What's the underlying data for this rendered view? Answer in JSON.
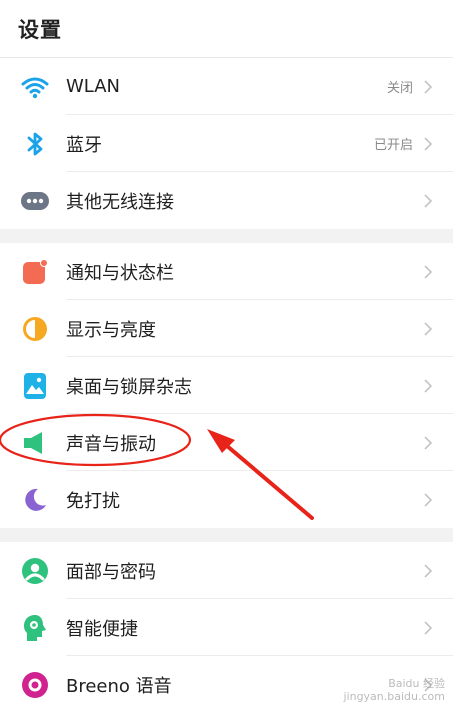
{
  "header": {
    "title": "设置"
  },
  "groups": [
    {
      "items": [
        {
          "label": "WLAN",
          "value": "关闭",
          "icon": "wifi-icon"
        },
        {
          "label": "蓝牙",
          "value": "已开启",
          "icon": "bluetooth-icon"
        },
        {
          "label": "其他无线连接",
          "value": "",
          "icon": "more-connections-icon"
        }
      ]
    },
    {
      "items": [
        {
          "label": "通知与状态栏",
          "value": "",
          "icon": "notification-icon"
        },
        {
          "label": "显示与亮度",
          "value": "",
          "icon": "display-brightness-icon"
        },
        {
          "label": "桌面与锁屏杂志",
          "value": "",
          "icon": "wallpaper-icon"
        },
        {
          "label": "声音与振动",
          "value": "",
          "icon": "sound-icon"
        },
        {
          "label": "免打扰",
          "value": "",
          "icon": "moon-icon"
        }
      ]
    },
    {
      "items": [
        {
          "label": "面部与密码",
          "value": "",
          "icon": "face-password-icon"
        },
        {
          "label": "智能便捷",
          "value": "",
          "icon": "smart-assist-icon"
        },
        {
          "label": "Breeno 语音",
          "value": "",
          "icon": "breeno-icon"
        }
      ]
    }
  ],
  "annotation_color": "#e8231a",
  "watermark": {
    "line1": "Baidu 经验",
    "line2": "jingyan.baidu.com"
  }
}
